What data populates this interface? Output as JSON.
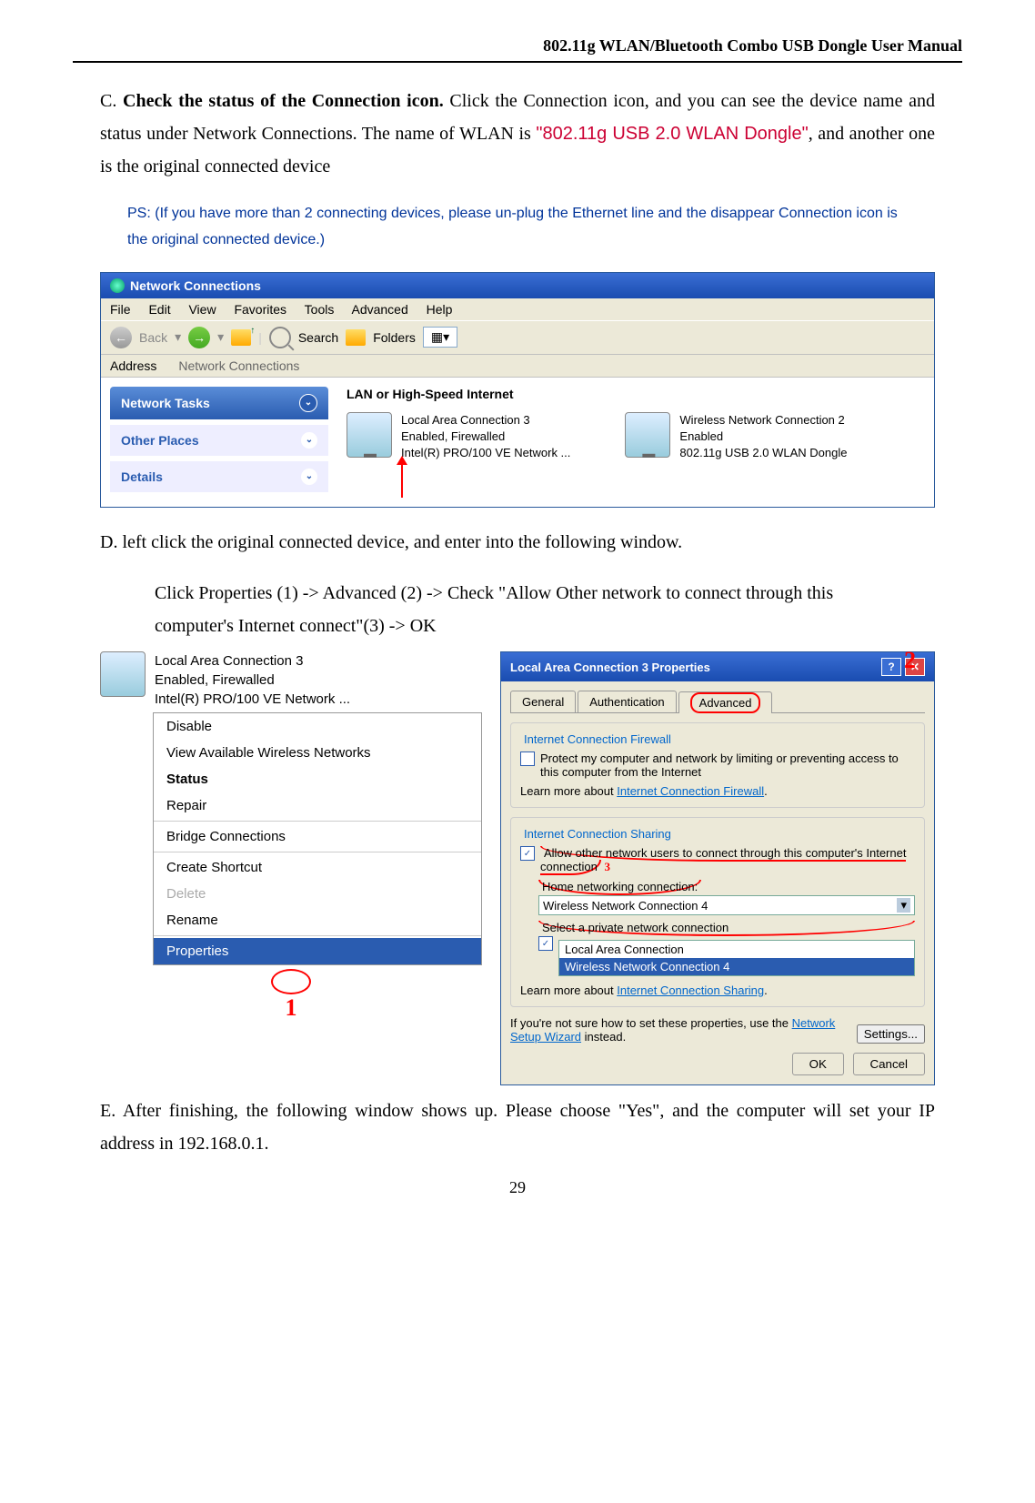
{
  "header": "802.11g WLAN/Bluetooth Combo USB Dongle User Manual",
  "section_c": {
    "label": "C.",
    "bold": "Check the status of the Connection icon.",
    "text": " Click the Connection icon, and you can see the device name and status under Network Connections. The name of WLAN is ",
    "red": "\"802.11g USB 2.0 WLAN Dongle\"",
    "text2": ", and another one is the original connected device"
  },
  "ps": "PS: (If you have more than 2 connecting devices, please un-plug the Ethernet line and the disappear Connection icon is the original connected device.)",
  "nc_win": {
    "title": "Network Connections",
    "menu": [
      "File",
      "Edit",
      "View",
      "Favorites",
      "Tools",
      "Advanced",
      "Help"
    ],
    "toolbar": {
      "back": "Back",
      "search": "Search",
      "folders": "Folders"
    },
    "address_label": "Address",
    "address_value": "Network Connections",
    "sidebar": {
      "tasks": "Network Tasks",
      "other": "Other Places",
      "details": "Details"
    },
    "section": "LAN or High-Speed Internet",
    "conn1": {
      "name": "Local Area Connection 3",
      "status": "Enabled, Firewalled",
      "device": "Intel(R) PRO/100 VE Network ..."
    },
    "conn2": {
      "name": "Wireless Network Connection 2",
      "status": "Enabled",
      "device": "802.11g USB 2.0 WLAN Dongle"
    }
  },
  "section_d": {
    "label": "D.",
    "text": "left click the original connected device, and enter into the following window.",
    "line2_a": "Click ",
    "line2_b": "Properties (1) -> Advanced (2) ->",
    "line2_c": " Check ",
    "line2_d": "\"Allow Other network to connect through this computer's Internet connect\"",
    "line2_e": "(3) -> OK"
  },
  "ctx": {
    "header": {
      "name": "Local Area Connection 3",
      "status": "Enabled, Firewalled",
      "device": "Intel(R) PRO/100 VE Network ..."
    },
    "items": [
      "Disable",
      "View Available Wireless Networks",
      "Status",
      "Repair",
      "Bridge Connections",
      "Create Shortcut",
      "Delete",
      "Rename",
      "Properties"
    ],
    "marker1": "1"
  },
  "props": {
    "title": "Local Area Connection 3 Properties",
    "marker2": "2",
    "tabs": [
      "General",
      "Authentication",
      "Advanced"
    ],
    "fw_legend": "Internet Connection Firewall",
    "fw_chk": "Protect my computer and network by limiting or preventing access to this computer from the Internet",
    "fw_learn": "Learn more about ",
    "fw_link": "Internet Connection Firewall",
    "ics_legend": "Internet Connection Sharing",
    "ics_chk": "Allow other network users to connect through this computer's Internet connection",
    "marker3": "3",
    "home_label": "Home networking connection:",
    "home_sel": "Wireless Network Connection 4",
    "priv_label": "Select a private network connection",
    "priv_opts": [
      "Local Area Connection",
      "Wireless Network Connection 4"
    ],
    "ics_learn": "Learn more about ",
    "ics_link": "Internet Connection Sharing",
    "help": "If you're not sure how to set these properties, use the ",
    "help_link": "Network Setup Wizard",
    "help2": " instead.",
    "settings": "Settings...",
    "ok": "OK",
    "cancel": "Cancel"
  },
  "section_e": {
    "label": "E.",
    "text": "After finishing, the following window shows up. Please choose \"Yes\", and the computer will set your IP address in 192.168.0.1."
  },
  "page_num": "29"
}
